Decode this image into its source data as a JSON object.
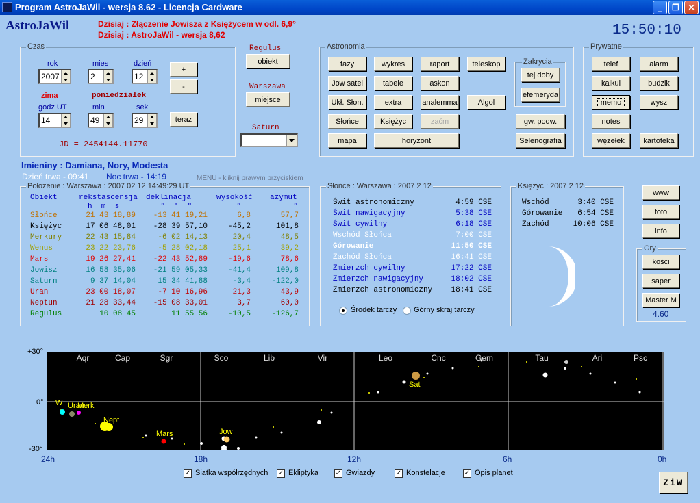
{
  "window": {
    "title": "Program AstroJaWil - wersja 8.62 - Licencja Cardware",
    "min": "_",
    "max": "❐",
    "close": "✕"
  },
  "header": {
    "logo": "AstroJaWil",
    "news1": "Dzisiaj : Złączenie Jowisza z Księżycem w odl. 6,9°",
    "news2": "Dzisiaj : AstroJaWil - wersja 8,62",
    "clock": "15:50:10"
  },
  "czas": {
    "title": "Czas",
    "rok_label": "rok",
    "mies_label": "mies",
    "dzien_label": "dzień",
    "rok": "2007",
    "mies": "2",
    "dzien": "12",
    "plus": "+",
    "minus": "-",
    "season": "zima",
    "weekday": "poniedziałek",
    "godz_label": "godz UT",
    "min_label": "min",
    "sek_label": "sek",
    "godz": "14",
    "min": "49",
    "sek": "29",
    "teraz": "teraz",
    "jd": "JD =  2454144.11770"
  },
  "middle": {
    "regulus": "Regulus",
    "obiekt": "obiekt",
    "warszawa": "Warszawa",
    "miejsce": "miejsce",
    "saturn": "Saturn"
  },
  "astronomia": {
    "title": "Astronomia",
    "b": [
      "fazy",
      "wykres",
      "raport",
      "teleskop",
      "Jow satel",
      "tabele",
      "askon",
      "Ukł. Słon.",
      "extra",
      "analemma",
      "Algol",
      "Słońce",
      "Księżyc",
      "zaćm",
      "mapa",
      "horyzont",
      "gw. podw.",
      "Selenografia"
    ],
    "zakrycia": "Zakrycia",
    "tej_doby": "tej doby",
    "efemeryda": "efemeryda"
  },
  "prywatne": {
    "title": "Prywatne",
    "b": [
      "telef",
      "alarm",
      "kalkul",
      "budzik",
      "memo",
      "wysz",
      "notes",
      "węzełek",
      "kartoteka"
    ]
  },
  "imieniny": "Imieniny : Damiana, Nory, Modesta",
  "dzien_trwa": "Dzień trwa - 09:41",
  "noc_trwa": "Noc trwa - 14:19",
  "menu_hint": "MENU - kliknij prawym przyciskiem",
  "positions": {
    "title": "Położenie : Warszawa : 2007 02 12   14:49:29 UT",
    "headers": [
      "Obiekt",
      "rekstascensja",
      "deklinacja",
      "wysokość",
      "azymut"
    ],
    "subheaders": [
      "h  m  s",
      "°  '  \"",
      "°",
      "°"
    ],
    "rows": [
      {
        "name": "Słońce",
        "ra": "21 43 18,89",
        "dec": "-13 41 19,21",
        "alt": "6,8",
        "az": "57,7",
        "color": "#c07000"
      },
      {
        "name": "Księżyc",
        "ra": "17 06 48,01",
        "dec": "-28 39 57,10",
        "alt": "-45,2",
        "az": "101,8",
        "color": "#000000"
      },
      {
        "name": "Merkury",
        "ra": "22 43 15,84",
        "dec": "-6 02 14,13",
        "alt": "20,4",
        "az": "48,5",
        "color": "#808000"
      },
      {
        "name": "Wenus",
        "ra": "23 22 23,76",
        "dec": "-5 28 02,18",
        "alt": "25,1",
        "az": "39,2",
        "color": "#a0a000"
      },
      {
        "name": "Mars",
        "ra": "19 26 27,41",
        "dec": "-22 43 52,89",
        "alt": "-19,6",
        "az": "78,6",
        "color": "#e00000"
      },
      {
        "name": "Jowisz",
        "ra": "16 58 35,06",
        "dec": "-21 59 05,33",
        "alt": "-41,4",
        "az": "109,8",
        "color": "#008080"
      },
      {
        "name": "Saturn",
        "ra": "9 37 14,04",
        "dec": "15 34 41,88",
        "alt": "-3,4",
        "az": "-122,0",
        "color": "#008080"
      },
      {
        "name": "Uran",
        "ra": "23 00 18,07",
        "dec": "-7 10 16,96",
        "alt": "21,3",
        "az": "43,9",
        "color": "#c00000"
      },
      {
        "name": "Neptun",
        "ra": "21 28 33,44",
        "dec": "-15 08 33,01",
        "alt": "3,7",
        "az": "60,0",
        "color": "#a00000"
      },
      {
        "name": "Regulus",
        "ra": "10 08 45",
        "dec": "11 55 56",
        "alt": "-10,5",
        "az": "-126,7",
        "color": "#008000"
      }
    ]
  },
  "sun": {
    "title": "Słońce : Warszawa : 2007  2  12",
    "rows": [
      {
        "l": "Świt astronomiczny",
        "t": "4:59 CSE",
        "c": "#000000"
      },
      {
        "l": "Świt nawigacyjny",
        "t": "5:38 CSE",
        "c": "#0000c0"
      },
      {
        "l": "Świt cywilny",
        "t": "6:18 CSE",
        "c": "#0000c0"
      },
      {
        "l": "Wschód Słońca",
        "t": "7:00 CSE",
        "c": "#ffffff"
      },
      {
        "l": "Górowanie",
        "t": "11:50 CSE",
        "c": "#ffffff"
      },
      {
        "l": "Zachód Słońca",
        "t": "16:41 CSE",
        "c": "#ffffff"
      },
      {
        "l": "Zmierzch cywilny",
        "t": "17:22 CSE",
        "c": "#0000c0"
      },
      {
        "l": "Zmierzch nawigacyjny",
        "t": "18:02 CSE",
        "c": "#0000c0"
      },
      {
        "l": "Zmierzch astronomiczny",
        "t": "18:41 CSE",
        "c": "#000000"
      }
    ],
    "r1": "Środek tarczy",
    "r2": "Górny skraj tarczy"
  },
  "moon": {
    "title": "Księżyc : 2007  2  12",
    "rows": [
      {
        "l": "Wschód",
        "t": "3:40 CSE"
      },
      {
        "l": "Górowanie",
        "t": "6:54 CSE"
      },
      {
        "l": "Zachód",
        "t": "10:06 CSE"
      }
    ]
  },
  "right": {
    "www": "www",
    "foto": "foto",
    "info": "info",
    "gry": "Gry",
    "kosci": "kości",
    "saper": "saper",
    "master": "Master M",
    "ver": "4.60"
  },
  "sky": {
    "top_label": "+30°",
    "mid_label": "0°",
    "bot_label": "-30°",
    "x_labels": [
      "24h",
      "18h",
      "12h",
      "6h",
      "0h"
    ],
    "constellations": [
      "Aqr",
      "Cap",
      "Sgr",
      "Sco",
      "Lib",
      "Vir",
      "Leo",
      "Cnc",
      "Gem",
      "Tau",
      "Ari",
      "Psc"
    ],
    "planets": [
      "W",
      "Uran",
      "Merk",
      "Nept",
      "Mars",
      "Jow",
      "Sat"
    ],
    "options": [
      "Siatka współrzędnych",
      "Ekliptyka",
      "Gwiazdy",
      "Konstelacje",
      "Opis planet"
    ],
    "ziw": "ZiW"
  }
}
